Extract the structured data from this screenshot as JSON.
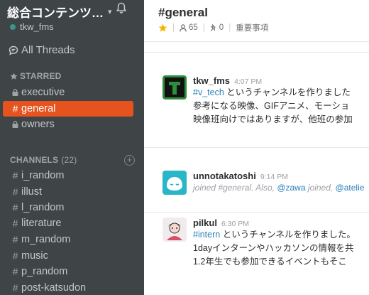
{
  "team": {
    "name": "総合コンテンツ…",
    "caret": "⌄",
    "user": "tkw_fms"
  },
  "nav": {
    "all_threads": "All Threads"
  },
  "starred": {
    "title": "STARRED",
    "items": [
      {
        "label": "executive",
        "private": true
      },
      {
        "label": "general",
        "private": false,
        "active": true
      },
      {
        "label": "owners",
        "private": true
      }
    ]
  },
  "channels": {
    "title": "CHANNELS",
    "count": "(22)",
    "items": [
      {
        "label": "i_random"
      },
      {
        "label": "illust"
      },
      {
        "label": "l_random"
      },
      {
        "label": "literature"
      },
      {
        "label": "m_random"
      },
      {
        "label": "music"
      },
      {
        "label": "p_random"
      },
      {
        "label": "post-katsudon"
      }
    ]
  },
  "channel": {
    "title": "#general",
    "members": "65",
    "pins": "0",
    "purpose": "重要事項"
  },
  "messages": [
    {
      "author": "tkw_fms",
      "time": "4:07 PM",
      "link": "#v_tech",
      "line1": " というチャンネルを作りました",
      "line2": "参考になる映像、GIFアニメ、モーショ",
      "line3": "映像班向けではありますが、他班の参加"
    },
    {
      "author": "unnotakatoshi",
      "time": "9:14 PM",
      "joined_prefix": "joined #general. Also, ",
      "mention1": "@zawa",
      "joined_mid": " joined, ",
      "mention2": "@atelie"
    },
    {
      "author": "pilkul",
      "time": "6:30 PM",
      "link": "#intern",
      "line1": " というチャンネルを作りました。",
      "line2": "1dayインターンやハッカソンの情報を共",
      "line3": "1.2年生でも参加できるイベントもそこ"
    }
  ],
  "colors": {
    "sidebar_bg": "#3f4447",
    "active_channel": "#e6531f",
    "presence": "#38978d",
    "link": "#2a80b9"
  }
}
